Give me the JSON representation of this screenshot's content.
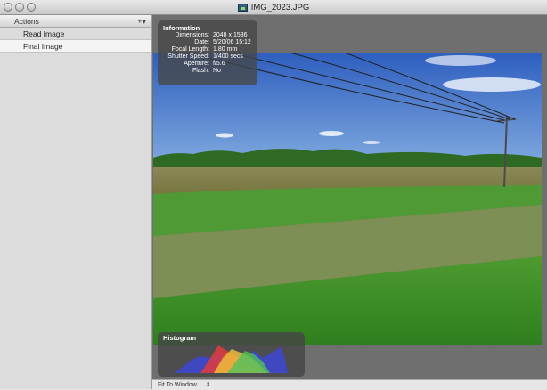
{
  "window": {
    "title": "IMG_2023.JPG",
    "controls": [
      "close-button",
      "minimize-button",
      "zoom-button"
    ]
  },
  "sidebar": {
    "header_label": "Actions",
    "add_label": "+▾",
    "steps": [
      {
        "label": "Read Image",
        "selected": false
      },
      {
        "label": "Final Image",
        "selected": true
      }
    ]
  },
  "info_panel": {
    "title": "Information",
    "rows": [
      {
        "key": "Dimensions:",
        "value": "2048 x 1536"
      },
      {
        "key": "Date:",
        "value": "5/20/06 15:12"
      },
      {
        "key": "Focal Length:",
        "value": "1.80 mm"
      },
      {
        "key": "Shutter Speed:",
        "value": "1/400 secs"
      },
      {
        "key": "Aperture:",
        "value": "f/5.6"
      },
      {
        "key": "Flash:",
        "value": "No"
      }
    ]
  },
  "histogram": {
    "title": "Histogram",
    "channel_colors": {
      "red": "#e33b3b",
      "green": "#52c25a",
      "blue": "#3d47d6",
      "yellow": "#f0c43a"
    }
  },
  "bottom_bar": {
    "zoom_label": "Fit To Window",
    "zoom_arrow": "⇕"
  },
  "colors": {
    "viewer_bg": "#6f6f6f",
    "sidebar_bg": "#dcdcdc",
    "sky": "#3f73c6",
    "grass": "#3f8f2b"
  }
}
